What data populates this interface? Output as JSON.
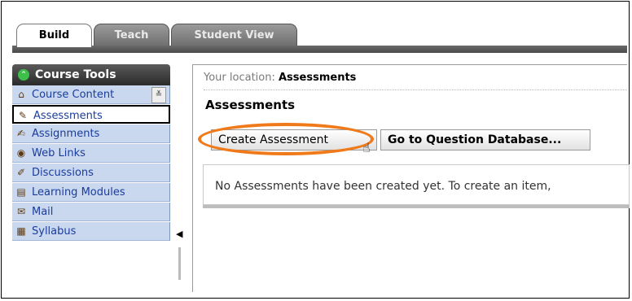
{
  "tabs": [
    {
      "label": "Build",
      "active": true
    },
    {
      "label": "Teach",
      "active": false
    },
    {
      "label": "Student View",
      "active": false
    }
  ],
  "sidebar": {
    "header": "Course Tools",
    "header_icon": "collapse-circle-icon",
    "collapse_glyph": "≚",
    "items": [
      {
        "label": "Course Content",
        "icon": "house-icon"
      },
      {
        "label": "Assessments",
        "icon": "assessment-icon",
        "selected": true
      },
      {
        "label": "Assignments",
        "icon": "assignment-icon"
      },
      {
        "label": "Web Links",
        "icon": "globe-icon"
      },
      {
        "label": "Discussions",
        "icon": "pin-icon"
      },
      {
        "label": "Learning Modules",
        "icon": "module-icon"
      },
      {
        "label": "Mail",
        "icon": "mail-icon"
      },
      {
        "label": "Syllabus",
        "icon": "syllabus-icon"
      }
    ]
  },
  "main": {
    "location_prefix": "Your location:",
    "location_current": "Assessments",
    "title": "Assessments",
    "create_button": "Create Assessment",
    "goto_button": "Go to Question Database...",
    "empty_message": "No Assessments have been created yet. To create an item,"
  },
  "colors": {
    "highlight": "#f07a1a",
    "nav_bg": "#c9d8ee",
    "nav_text": "#1a3c9c"
  }
}
